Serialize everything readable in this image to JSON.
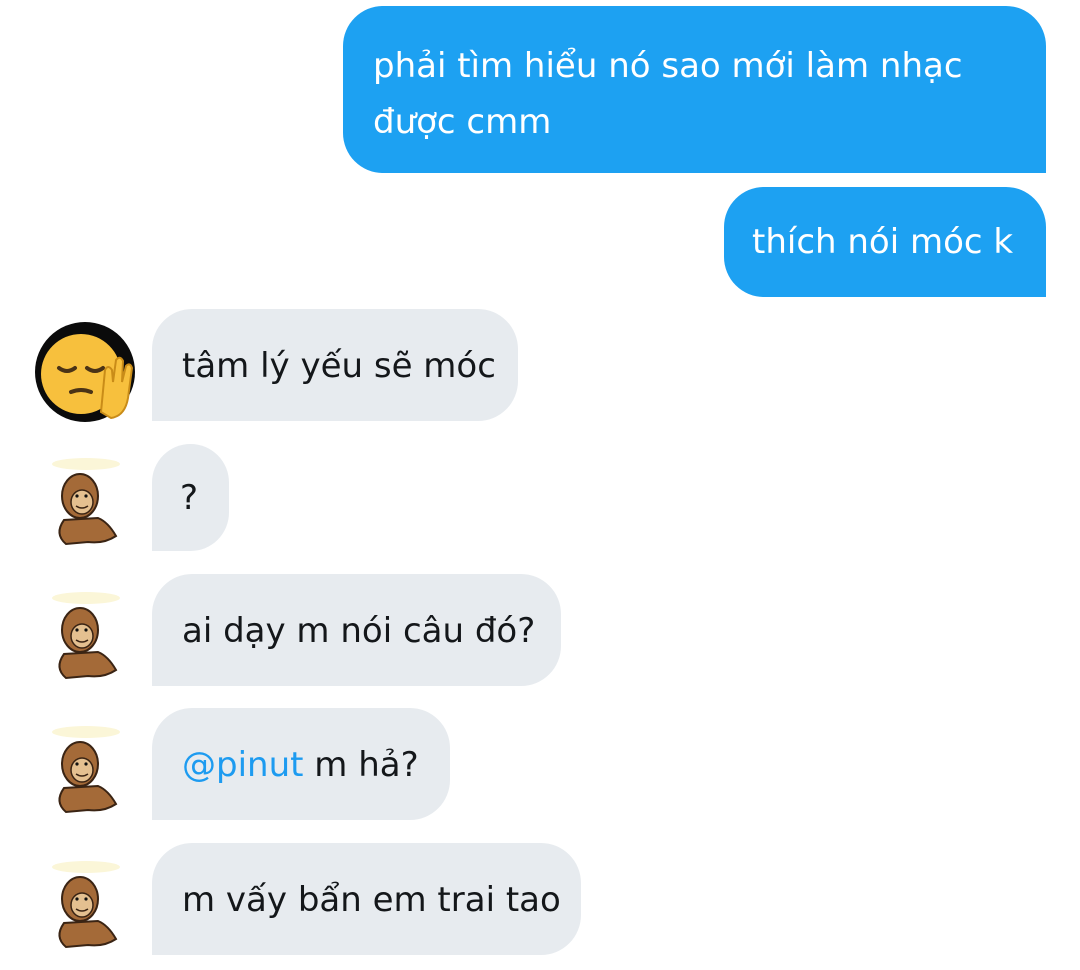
{
  "conversation": {
    "outgoing": [
      {
        "line1": "phải tìm hiểu nó sao mới làm nhạc",
        "line2": "được cmm"
      },
      {
        "text": "thích nói móc k"
      }
    ],
    "incoming": [
      {
        "text": "tâm lý yếu sẽ móc",
        "avatar_icon": "pensive-face-raised-hand-icon"
      },
      {
        "text": "?",
        "avatar_icon": "monkey-sticker-icon"
      },
      {
        "text": "ai dạy m nói câu đó?",
        "avatar_icon": "monkey-sticker-icon"
      },
      {
        "mention": "@pinut",
        "text": " m hả?",
        "avatar_icon": "monkey-sticker-icon"
      },
      {
        "text": "m vấy bẩn em trai tao",
        "avatar_icon": "monkey-sticker-icon"
      }
    ]
  },
  "colors": {
    "outgoing_bubble": "#1da1f2",
    "incoming_bubble": "#e7ebef",
    "mention": "#1d9bf0"
  }
}
